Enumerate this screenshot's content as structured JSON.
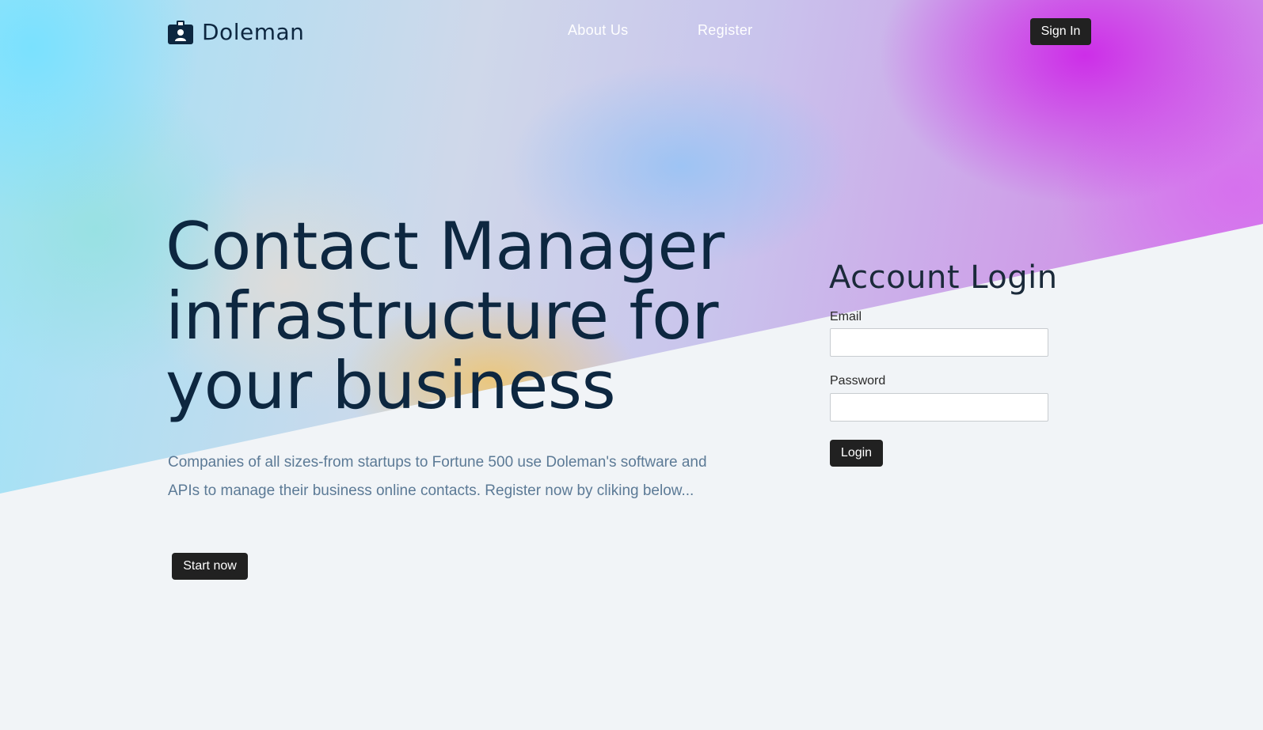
{
  "header": {
    "brand": "Doleman",
    "nav": {
      "about_label": "About Us",
      "register_label": "Register"
    },
    "signin_label": "Sign In"
  },
  "hero": {
    "headline": "Contact Manager infrastructure for your business",
    "subtext": "Companies of all sizes-from startups to Fortune 500 use Doleman's software and APIs to manage their business online contacts. Register now by cliking below...",
    "cta_label": "Start now"
  },
  "login": {
    "title": "Account Login",
    "email_label": "Email",
    "email_value": "",
    "password_label": "Password",
    "password_value": "",
    "submit_label": "Login"
  },
  "icons": {
    "logo": "id-badge-icon"
  },
  "colors": {
    "heading": "#0d2740",
    "subtext": "#5c7a96",
    "button_bg": "#212121",
    "button_text": "#ffffff",
    "page_bg": "#f1f4f7"
  }
}
